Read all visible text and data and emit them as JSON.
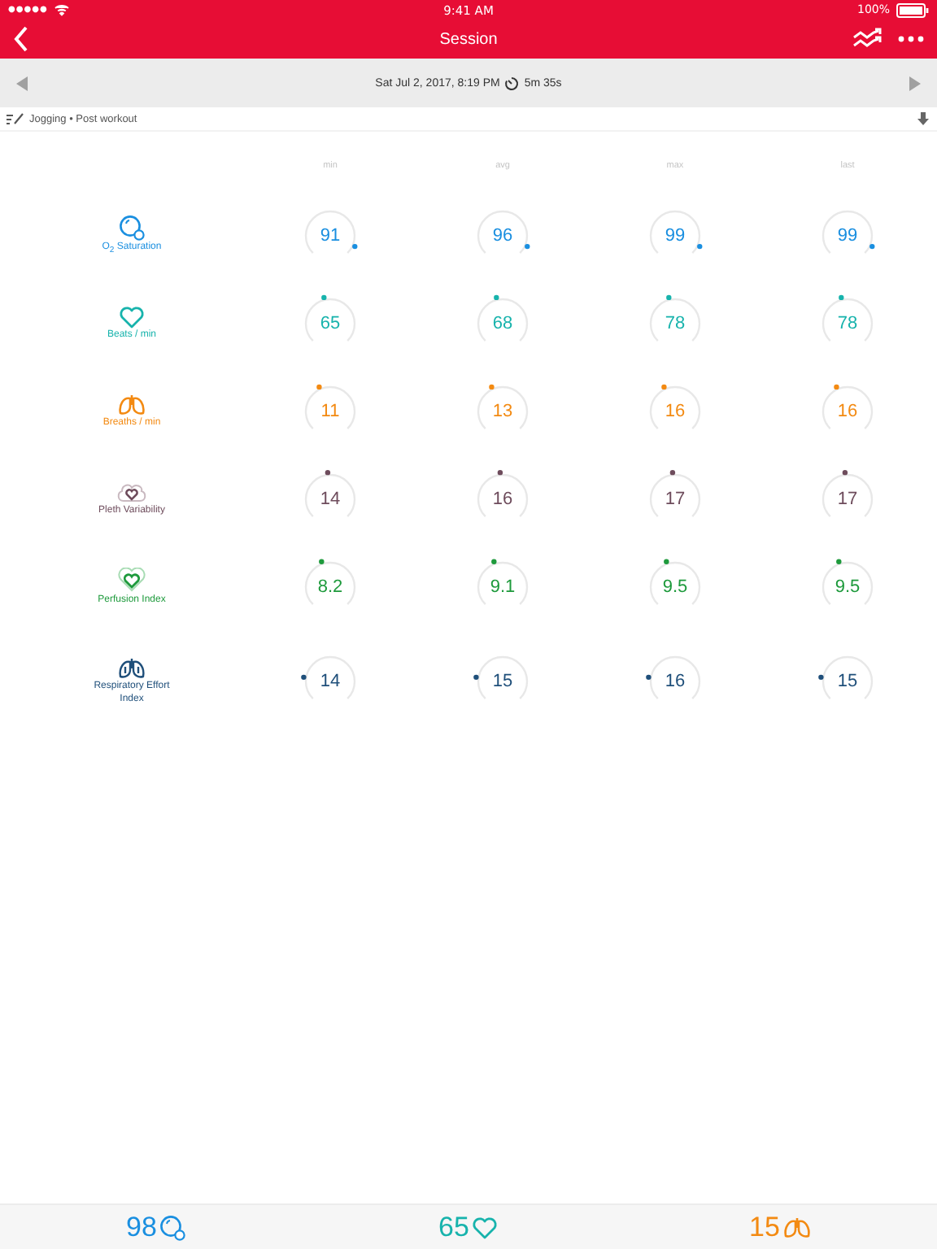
{
  "status_bar": {
    "signal": "●●●●●",
    "time": "9:41 AM",
    "battery": "100%"
  },
  "nav_bar": {
    "title": "Session"
  },
  "date_bar": {
    "date": "Sat Jul 2, 2017, 8:19 PM",
    "duration": "5m 35s"
  },
  "tags": {
    "text": "Jogging • Post workout"
  },
  "columns": [
    "min",
    "avg",
    "max",
    "last"
  ],
  "metrics": [
    {
      "kind": "oxygen",
      "label": "O$_{2}$ Saturation",
      "color": "#1a8fe0",
      "values": [
        "91",
        "96",
        "99",
        "99"
      ]
    },
    {
      "kind": "heart",
      "label": "Beats / min",
      "color": "#17b3ac",
      "values": [
        "65",
        "68",
        "78",
        "78"
      ]
    },
    {
      "kind": "lungs",
      "label": "Breaths / min",
      "color": "#f38a12",
      "values": [
        "11",
        "13",
        "16",
        "16"
      ]
    },
    {
      "kind": "pleth",
      "label": "Pleth Variability",
      "color": "#6e4c5c",
      "values": [
        "14",
        "16",
        "17",
        "17"
      ]
    },
    {
      "kind": "perfusion",
      "label": "Perfusion Index",
      "color": "#1e9a3c",
      "values": [
        "8.2",
        "9.1",
        "9.5",
        "9.5"
      ]
    },
    {
      "kind": "effort",
      "label": "Respiratory Effort Index",
      "color": "#1f4f7a",
      "values": [
        "14",
        "15",
        "16",
        "15"
      ]
    }
  ],
  "footer": [
    {
      "kind": "oxygen",
      "value": "98",
      "color": "#1a8fe0"
    },
    {
      "kind": "heart",
      "value": "65",
      "color": "#17b3ac"
    },
    {
      "kind": "lungs",
      "value": "15",
      "color": "#f38a12"
    }
  ]
}
